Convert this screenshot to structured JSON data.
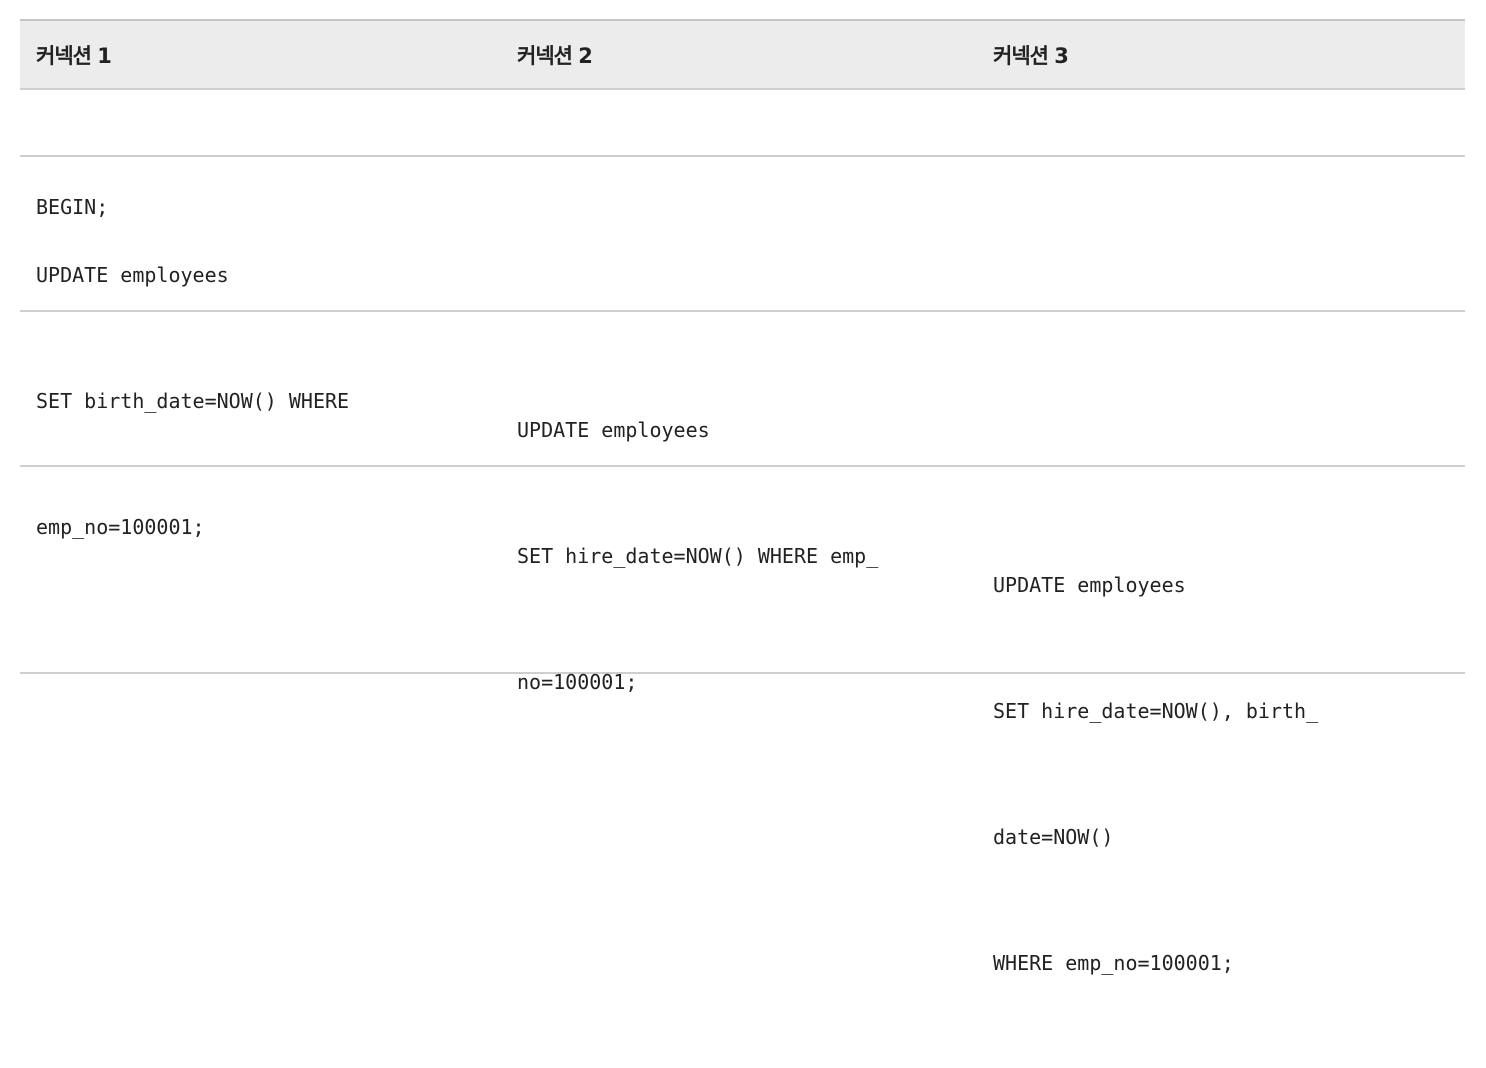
{
  "table": {
    "headers": [
      "커넥션 1",
      "커넥션 2",
      "커넥션 3"
    ],
    "rows": [
      [
        [
          "BEGIN;"
        ],
        [],
        []
      ],
      [
        [
          "UPDATE employees",
          "SET birth_date=NOW() WHERE",
          "emp_no=100001;"
        ],
        [],
        []
      ],
      [
        [],
        [
          "UPDATE employees",
          "SET hire_date=NOW() WHERE emp_",
          "no=100001;"
        ],
        []
      ],
      [
        [],
        [],
        [
          "UPDATE employees",
          "SET hire_date=NOW(), birth_",
          "date=NOW()",
          "WHERE emp_no=100001;"
        ]
      ]
    ]
  }
}
